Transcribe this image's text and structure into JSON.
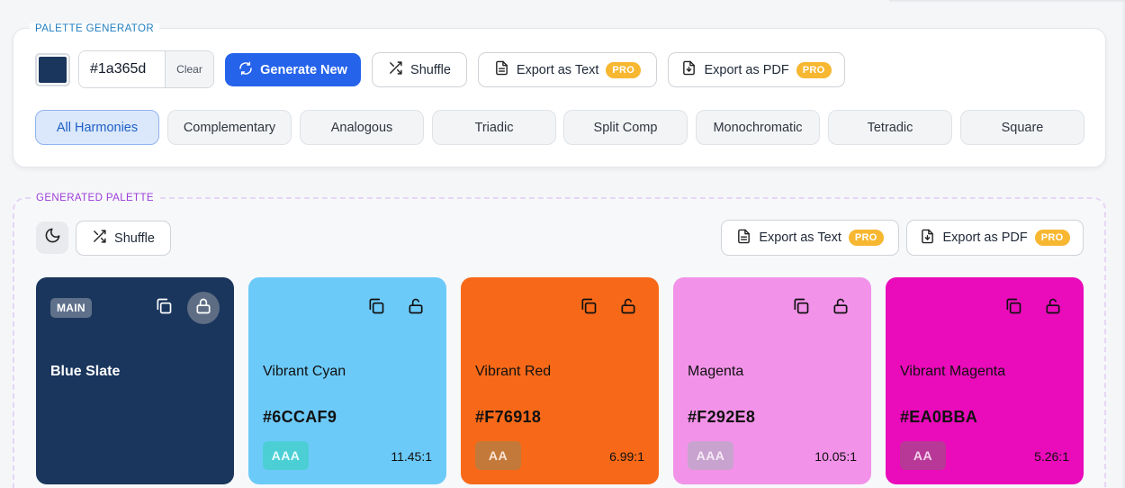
{
  "generator": {
    "section_label": "PALETTE GENERATOR",
    "current_color": "#1a365d",
    "hex_value": "#1a365d",
    "clear_label": "Clear",
    "generate_label": "Generate New",
    "shuffle_label": "Shuffle",
    "export_text_label": "Export as Text",
    "export_pdf_label": "Export as PDF",
    "pro_badge": "PRO",
    "harmonies": [
      {
        "label": "All Harmonies",
        "active": true
      },
      {
        "label": "Complementary",
        "active": false
      },
      {
        "label": "Analogous",
        "active": false
      },
      {
        "label": "Triadic",
        "active": false
      },
      {
        "label": "Split Comp",
        "active": false
      },
      {
        "label": "Monochromatic",
        "active": false
      },
      {
        "label": "Tetradic",
        "active": false
      },
      {
        "label": "Square",
        "active": false
      }
    ]
  },
  "palette": {
    "section_label": "GENERATED PALETTE",
    "shuffle_label": "Shuffle",
    "export_text_label": "Export as Text",
    "export_pdf_label": "Export as PDF",
    "pro_badge": "PRO",
    "main_badge": "MAIN",
    "colors": [
      {
        "name": "Blue Slate",
        "hex": "",
        "bg": "#1a365d",
        "fg": "#ffffff",
        "wcag": "",
        "ratio": "",
        "is_main": true
      },
      {
        "name": "Vibrant Cyan",
        "hex": "#6CCAF9",
        "bg": "#6ccaf9",
        "fg": "#111111",
        "wcag": "AAA",
        "wcag_bg": "#4bcfd5",
        "wcag_fg": "#e8fbfc",
        "ratio": "11.45:1",
        "is_main": false
      },
      {
        "name": "Vibrant Red",
        "hex": "#F76918",
        "bg": "#f76918",
        "fg": "#111111",
        "wcag": "AA",
        "wcag_bg": "#c3793a",
        "wcag_fg": "#fbe5d4",
        "ratio": "6.99:1",
        "is_main": false
      },
      {
        "name": "Magenta",
        "hex": "#F292E8",
        "bg": "#f292e8",
        "fg": "#111111",
        "wcag": "AAA",
        "wcag_bg": "#c9a3cf",
        "wcag_fg": "#f6eaf7",
        "ratio": "10.05:1",
        "is_main": false
      },
      {
        "name": "Vibrant Magenta",
        "hex": "#EA0BBA",
        "bg": "#ea0bba",
        "fg": "#111111",
        "wcag": "AA",
        "wcag_bg": "#b83897",
        "wcag_fg": "#f3d2ec",
        "ratio": "5.26:1",
        "is_main": false
      }
    ]
  }
}
